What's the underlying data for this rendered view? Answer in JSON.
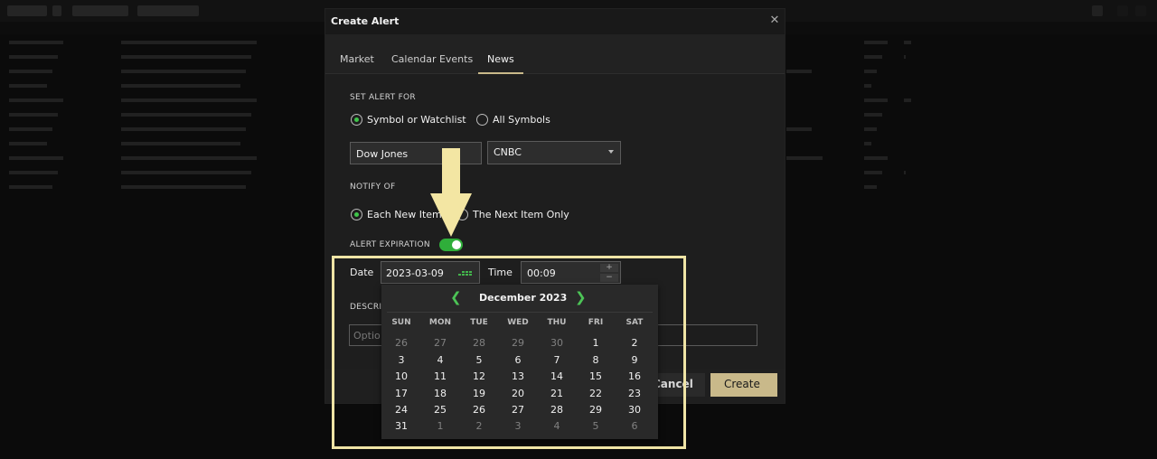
{
  "modal": {
    "title": "Create Alert",
    "close_icon": "close-icon",
    "tabs": [
      {
        "label": "Market",
        "active": false
      },
      {
        "label": "Calendar Events",
        "active": false
      },
      {
        "label": "News",
        "active": true
      }
    ],
    "set_alert_for": {
      "section_label": "SET ALERT FOR",
      "options": [
        {
          "label": "Symbol or Watchlist",
          "selected": true
        },
        {
          "label": "All Symbols",
          "selected": false
        }
      ],
      "symbol_value": "Dow Jones",
      "source_value": "CNBC"
    },
    "notify_of": {
      "section_label": "NOTIFY OF",
      "options": [
        {
          "label": "Each New Item",
          "selected": true
        },
        {
          "label": "The Next Item Only",
          "selected": false
        }
      ]
    },
    "alert_expiration": {
      "label": "ALERT EXPIRATION",
      "enabled": true,
      "date_label": "Date",
      "date_value": "2023-03-09",
      "time_label": "Time",
      "time_value": "00:09",
      "calendar_icon": "calendar-icon",
      "increment_symbol": "+",
      "decrement_symbol": "−"
    },
    "description": {
      "label": "DESCRI",
      "placeholder": "Optio"
    },
    "cancel_label": "Cancel",
    "create_label": "Create"
  },
  "date_picker": {
    "month_label": "December 2023",
    "prev_icon": "chevron-left-icon",
    "next_icon": "chevron-right-icon",
    "weekdays": [
      "SUN",
      "MON",
      "TUE",
      "WED",
      "THU",
      "FRI",
      "SAT"
    ],
    "weeks": [
      [
        "26",
        "27",
        "28",
        "29",
        "30",
        "1",
        "2"
      ],
      [
        "3",
        "4",
        "5",
        "6",
        "7",
        "8",
        "9"
      ],
      [
        "10",
        "11",
        "12",
        "13",
        "14",
        "15",
        "16"
      ],
      [
        "17",
        "18",
        "19",
        "20",
        "21",
        "22",
        "23"
      ],
      [
        "24",
        "25",
        "26",
        "27",
        "28",
        "29",
        "30"
      ],
      [
        "31",
        "1",
        "2",
        "3",
        "4",
        "5",
        "6"
      ]
    ],
    "outside_month": [
      [
        true,
        true,
        true,
        true,
        true,
        false,
        false
      ],
      [
        false,
        false,
        false,
        false,
        false,
        false,
        false
      ],
      [
        false,
        false,
        false,
        false,
        false,
        false,
        false
      ],
      [
        false,
        false,
        false,
        false,
        false,
        false,
        false
      ],
      [
        false,
        false,
        false,
        false,
        false,
        false,
        false
      ],
      [
        false,
        true,
        true,
        true,
        true,
        true,
        true
      ]
    ]
  },
  "colors": {
    "accent_green": "#3fc44a",
    "create_button": "#c9b98a",
    "highlight_box": "#efe4a5",
    "arrow": "#f3e6a3"
  },
  "annotation_icon": "down-arrow-icon"
}
